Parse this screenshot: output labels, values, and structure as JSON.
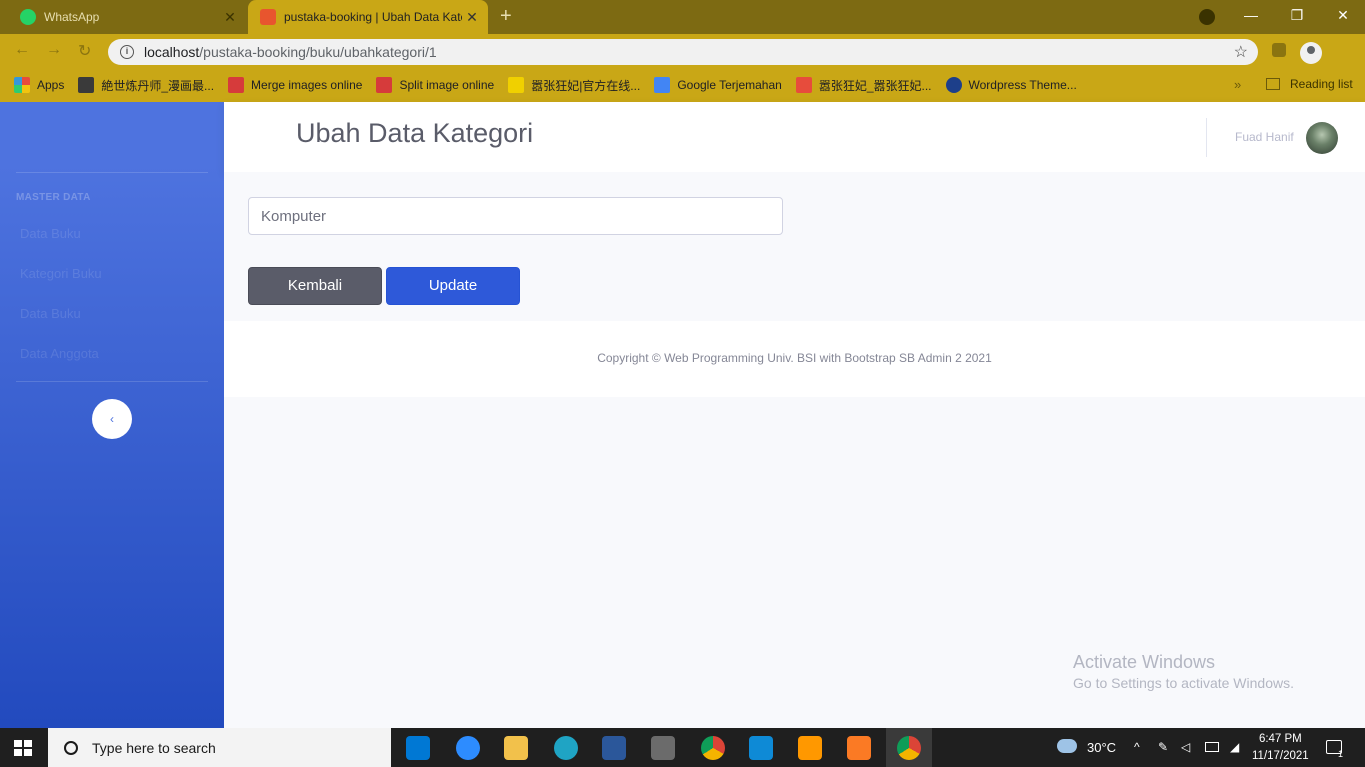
{
  "browser": {
    "tabs": [
      {
        "title": "WhatsApp",
        "active": false,
        "favicon_color": "#25d366"
      },
      {
        "title": "pustaka-booking | Ubah Data Kategori",
        "active": true,
        "favicon_color": "#e8552e"
      }
    ],
    "new_tab_symbol": "+",
    "window_controls": {
      "minimize": "—",
      "restore": "❐",
      "close": "✕"
    },
    "url_host": "localhost",
    "url_path": "/pustaka-booking/buku/ubahkategori/1",
    "bookmarks": [
      {
        "label": "Apps",
        "icon_color": "#e74c3c"
      },
      {
        "label": "絶世炼丹师_漫画最...",
        "icon_color": "#3a3a3a"
      },
      {
        "label": "Merge images online",
        "icon_color": "#d63b3b"
      },
      {
        "label": "Split image online",
        "icon_color": "#d63b3b"
      },
      {
        "label": "嚣张狂妃|官方在线...",
        "icon_color": "#f0d000"
      },
      {
        "label": "Google Terjemahan",
        "icon_color": "#4285f4"
      },
      {
        "label": "嚣张狂妃_嚣张狂妃...",
        "icon_color": "#e74c3c"
      },
      {
        "label": "Wordpress Theme...",
        "icon_color": "#1d3f8a"
      }
    ],
    "bookmarks_more": "»",
    "reading_list": "Reading list"
  },
  "sidebar": {
    "heading": "MASTER DATA",
    "items": [
      {
        "label": "Data Buku"
      },
      {
        "label": "Kategori Buku"
      },
      {
        "label": "Data Buku"
      },
      {
        "label": "Data Anggota"
      }
    ],
    "toggle_symbol": "‹"
  },
  "topbar": {
    "title": "Ubah Data Kategori",
    "username": "Fuad Hanif"
  },
  "form": {
    "kategori_value": "Komputer",
    "back_label": "Kembali",
    "update_label": "Update"
  },
  "footer": {
    "copyright": "Copyright © Web Programming Univ. BSI with Bootstrap SB Admin 2 2021"
  },
  "watermark": {
    "line1": "Activate Windows",
    "line2": "Go to Settings to activate Windows."
  },
  "taskbar": {
    "search_placeholder": "Type here to search",
    "weather": "30°C",
    "time": "6:47 PM",
    "date": "11/17/2021",
    "notification_count": "1",
    "apps": [
      {
        "name": "store",
        "color": "#0078d4"
      },
      {
        "name": "zoom",
        "color": "#2d8cff"
      },
      {
        "name": "file-explorer",
        "color": "#f2c14b"
      },
      {
        "name": "edge",
        "color": "#1fa4c4"
      },
      {
        "name": "word",
        "color": "#2b579a"
      },
      {
        "name": "media-player",
        "color": "#6b6b6b"
      },
      {
        "name": "chrome",
        "color": "#db4437"
      },
      {
        "name": "vscode",
        "color": "#0e8ad6"
      },
      {
        "name": "sublime-text",
        "color": "#ff9800"
      },
      {
        "name": "xampp",
        "color": "#fb7a24"
      },
      {
        "name": "chrome",
        "color": "#db4437"
      }
    ]
  }
}
